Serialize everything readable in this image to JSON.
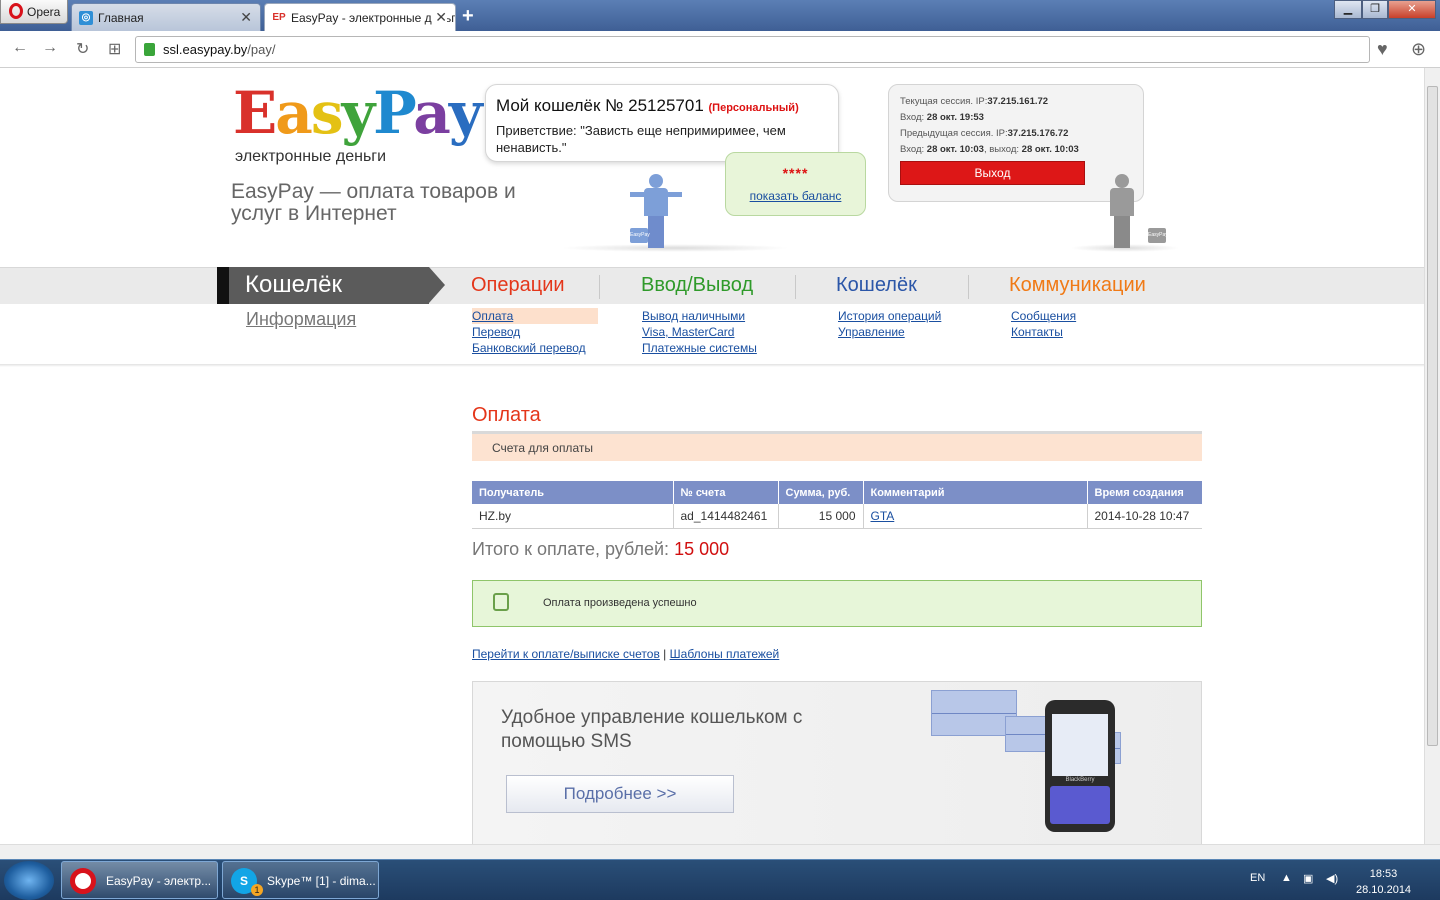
{
  "browser": {
    "menu_label": "Opera",
    "tabs": [
      {
        "label": "Главная",
        "active": false
      },
      {
        "label": "EasyPay - электронные деньги",
        "active": true
      }
    ],
    "url_host": "ssl.easypay.by",
    "url_path": "/pay/"
  },
  "header": {
    "logo_text": "EasyPay",
    "logo_subtitle": "электронные деньги",
    "tagline": "EasyPay — оплата товаров и услуг в Интернет",
    "wallet_title": "Мой кошелёк № 25125701",
    "wallet_type": "(Персональный)",
    "greeting": "Приветствие: \"Зависть еще непримиримее, чем ненависть.\"",
    "balance_masked": "****",
    "show_balance": "показать баланс",
    "suitcase_label": "EasyPay",
    "session": {
      "current_label": "Текущая сессия. IP:",
      "current_ip": "37.215.161.72",
      "current_login_label": "Вход:",
      "current_login": "28 окт. 19:53",
      "previous_label": "Предыдущая сессия. IP:",
      "previous_ip": "37.215.176.72",
      "previous_login_label": "Вход:",
      "previous_login": "28 окт. 10:03",
      "previous_logout_label": ", выход:",
      "previous_logout": "28 окт. 10:03"
    },
    "logout": "Выход"
  },
  "nav": {
    "active_section": "Кошелёк",
    "info_link": "Информация",
    "sections": [
      {
        "title": "Операции",
        "color": "#e4361a",
        "links": [
          "Оплата",
          "Перевод",
          "Банковский перевод"
        ]
      },
      {
        "title": "Ввод/Вывод",
        "color": "#2f9a2a",
        "links": [
          "Вывод наличными",
          "Visa, MasterCard",
          "Платежные системы"
        ]
      },
      {
        "title": "Кошелёк",
        "color": "#2b56a8",
        "links": [
          "История операций",
          "Управление"
        ]
      },
      {
        "title": "Коммуникации",
        "color": "#f07a16",
        "links": [
          "Сообщения",
          "Контакты"
        ]
      }
    ]
  },
  "content": {
    "title": "Оплата",
    "section_label": "Счета для оплаты",
    "table": {
      "headers": [
        "Получатель",
        "№ счета",
        "Сумма, руб.",
        "Комментарий",
        "Время создания"
      ],
      "rows": [
        [
          "HZ.by",
          "ad_1414482461",
          "15 000",
          "GTA",
          "2014-10-28 10:47"
        ]
      ]
    },
    "total_label": "Итого к оплате, рублей:",
    "total_value": "15 000",
    "success_message": "Оплата произведена успешно",
    "link_pay": "Перейти к оплате/выписке счетов",
    "link_separator": "|",
    "link_templates": "Шаблоны платежей",
    "promo_title": "Удобное управление кошельком с помощью SMS",
    "promo_button": "Подробнее >>",
    "phone_brand": "BlackBerry"
  },
  "taskbar": {
    "items": [
      "EasyPay - электр...",
      "Skype™ [1] - dima..."
    ],
    "skype_badge": "1",
    "lang": "EN",
    "time": "18:53",
    "date": "28.10.2014"
  }
}
